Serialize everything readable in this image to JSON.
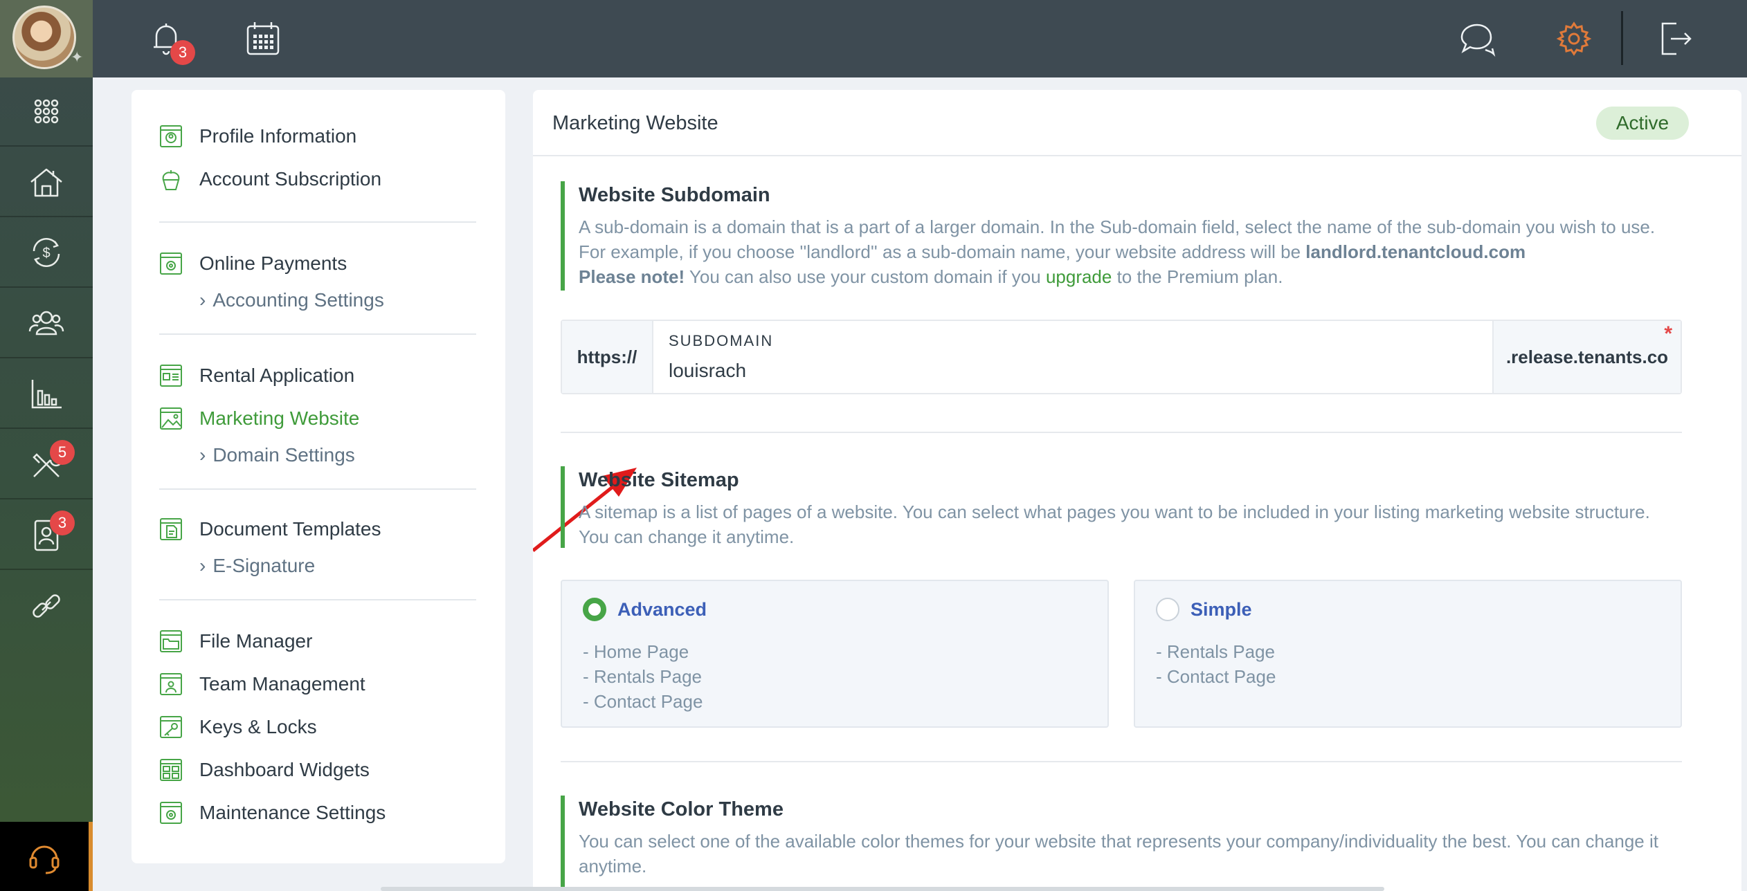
{
  "topbar": {
    "notifications_count": "3",
    "icons": [
      "bell-icon",
      "calendar-icon",
      "chat-icon",
      "gear-icon",
      "logout-icon"
    ]
  },
  "rail": {
    "items": [
      {
        "icon": "apps-grid-icon"
      },
      {
        "icon": "properties-icon"
      },
      {
        "icon": "payments-icon"
      },
      {
        "icon": "users-icon"
      },
      {
        "icon": "reports-icon"
      },
      {
        "icon": "maintenance-icon",
        "badge": "5"
      },
      {
        "icon": "applications-icon",
        "badge": "3"
      },
      {
        "icon": "link-icon"
      }
    ],
    "help_icon": "headset-icon"
  },
  "menu": {
    "groups": [
      {
        "items": [
          {
            "label": "Profile Information"
          },
          {
            "label": "Account Subscription"
          }
        ]
      },
      {
        "items": [
          {
            "label": "Online Payments"
          }
        ],
        "sub": "Accounting Settings"
      },
      {
        "items": [
          {
            "label": "Rental Application"
          },
          {
            "label": "Marketing Website"
          }
        ],
        "sub": "Domain Settings"
      },
      {
        "items": [
          {
            "label": "Document Templates"
          }
        ],
        "sub": "E-Signature"
      },
      {
        "items": [
          {
            "label": "File Manager"
          },
          {
            "label": "Team Management"
          },
          {
            "label": "Keys & Locks"
          },
          {
            "label": "Dashboard Widgets"
          },
          {
            "label": "Maintenance Settings"
          }
        ]
      }
    ],
    "active": "Marketing Website"
  },
  "main": {
    "title": "Marketing Website",
    "status": "Active",
    "subdomain_section": {
      "title": "Website Subdomain",
      "desc_1": "A sub-domain is a domain that is a part of a larger domain. In the Sub-domain field, select the name of the sub-domain you wish to use. For example, if you choose ''landlord'' as a sub-domain name, your website address will be ",
      "desc_bold": "landlord.tenantcloud.com",
      "note_bold": "Please note!",
      "note_1": " You can also use your custom domain if you ",
      "note_link": "upgrade",
      "note_2": " to the Premium plan."
    },
    "subdomain_field": {
      "prefix": "https://",
      "label": "SUBDOMAIN",
      "value": "louisrach",
      "suffix": ".release.tenants.co",
      "required_mark": "*"
    },
    "sitemap_section": {
      "title": "Website Sitemap",
      "desc": "A sitemap is a list of pages of a website. You can select what pages you want to be included in your listing marketing website structure. You can change it anytime."
    },
    "sitemap_options": [
      {
        "label": "Advanced",
        "selected": true,
        "pages": [
          "- Home Page",
          "- Rentals Page",
          "- Contact Page"
        ]
      },
      {
        "label": "Simple",
        "selected": false,
        "pages": [
          "- Rentals Page",
          "- Contact Page"
        ]
      }
    ],
    "color_section": {
      "title": "Website Color Theme",
      "desc": "You can select one of the available color themes for your website that represents your company/individuality the best. You can change it anytime."
    }
  },
  "colors": {
    "accent_green": "#47a547",
    "link_blue": "#3c5fb7",
    "badge_red": "#e44848",
    "gear_orange": "#e07a3a"
  }
}
